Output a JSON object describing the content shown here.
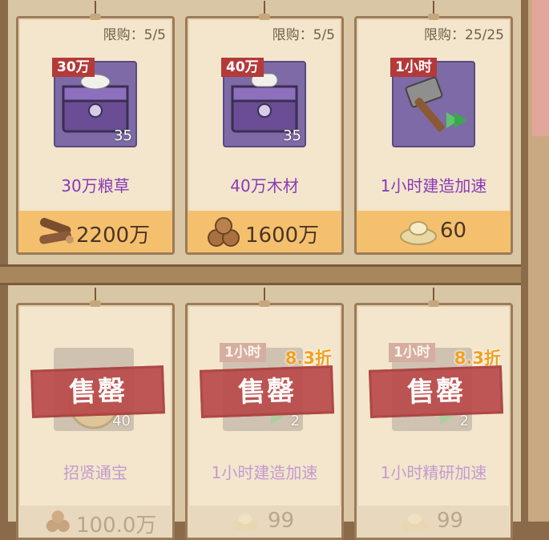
{
  "row1": [
    {
      "limit": "限购：5/5",
      "tag": "30万",
      "qty": "35",
      "name": "30万粮草",
      "price": "2200万",
      "currency_icon": "logs-icon",
      "status": "available"
    },
    {
      "limit": "限购：5/5",
      "tag": "40万",
      "qty": "35",
      "name": "40万木材",
      "price": "1600万",
      "currency_icon": "wood-bundle-icon",
      "status": "available"
    },
    {
      "limit": "限购：25/25",
      "tag": "1小时",
      "qty": "",
      "name": "1小时建造加速",
      "price": "60",
      "currency_icon": "silver-ingot-icon",
      "status": "available"
    }
  ],
  "row2": [
    {
      "limit": "",
      "tag": "",
      "discount": "",
      "qty": "40",
      "name": "招贤通宝",
      "price": "100.0万",
      "currency_icon": "wood-bundle-icon",
      "status": "sold",
      "sold_label": "售罄"
    },
    {
      "limit": "",
      "tag": "1小时",
      "discount": "8.3折",
      "qty": "2",
      "name": "1小时建造加速",
      "price": "99",
      "currency_icon": "silver-ingot-icon",
      "status": "sold",
      "sold_label": "售罄"
    },
    {
      "limit": "",
      "tag": "1小时",
      "discount": "8.3折",
      "qty": "2",
      "name": "1小时精研加速",
      "price": "99",
      "currency_icon": "silver-ingot-icon",
      "status": "sold",
      "sold_label": "售罄"
    }
  ],
  "colors": {
    "name_active": "#8a3ab8",
    "name_dim": "#c59bd0",
    "price_bar": "#f5c06e",
    "sold_stamp": "#b94a4a",
    "discount": "#f2a022"
  }
}
